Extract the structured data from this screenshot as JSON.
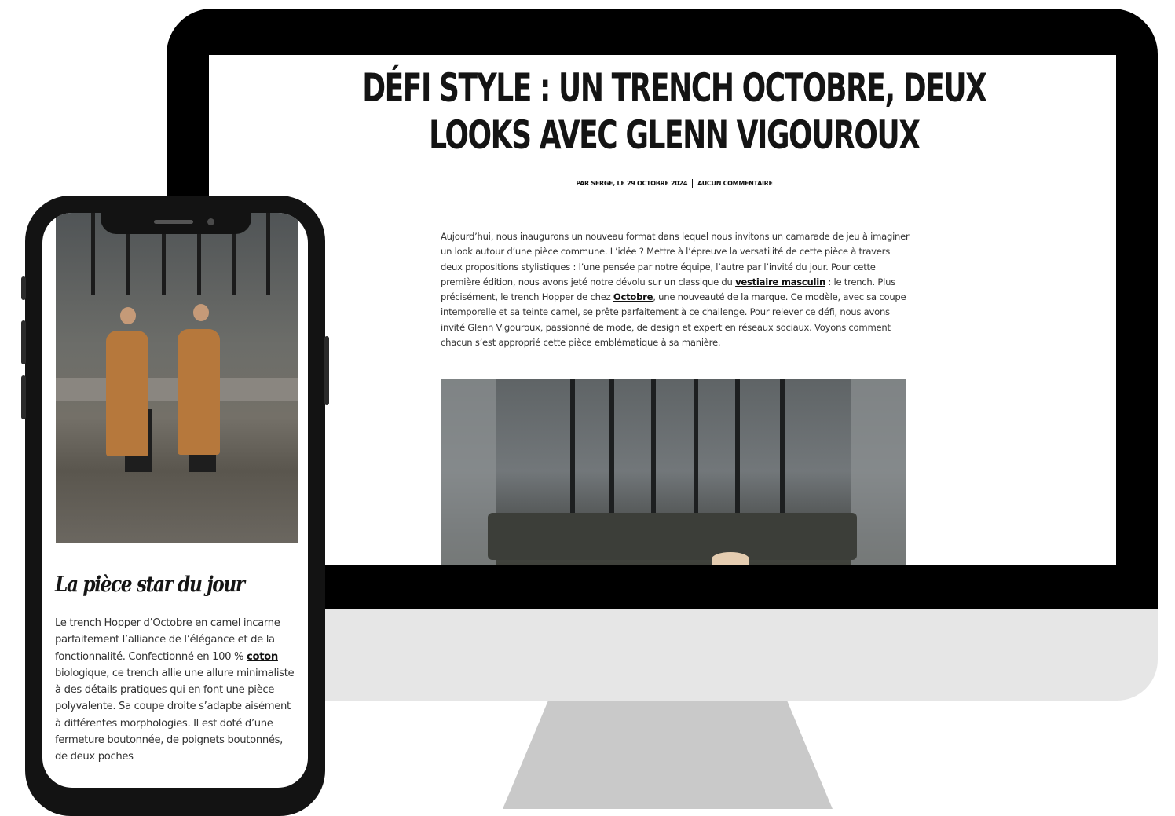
{
  "desktop": {
    "title": "DÉFI STYLE : UN TRENCH OCTOBRE, DEUX LOOKS AVEC GLENN VIGOUROUX",
    "byline": {
      "author_date": "PAR SERGE, LE 29 OCTOBRE 2024",
      "comments": "AUCUN COMMENTAIRE"
    },
    "intro": {
      "p1": "Aujourd’hui, nous inaugurons un nouveau format dans lequel nous invitons un camarade de jeu à imaginer un look autour d’une pièce commune. L’idée ? Mettre à l’épreuve la versatilité de cette pièce à travers deux propositions stylistiques : l’une pensée par notre équipe, l’autre par l’invité du jour. Pour cette première édition, nous avons jeté notre dévolu sur un classique du ",
      "link1": "vestiaire masculin",
      "p2": " : le trench. Plus précisément, le trench Hopper de chez ",
      "link2": "Octobre",
      "p3": ", une nouveauté de la marque. Ce modèle, avec sa coupe intemporelle et sa teinte camel, se prête parfaitement à ce challenge. Pour relever ce défi, nous avons invité Glenn Vigouroux, passionné de mode, de design et expert en réseaux sociaux. Voyons comment chacun s’est approprié cette pièce emblématique à sa manière."
    }
  },
  "mobile": {
    "heading": "La pièce star du jour",
    "body": {
      "p1": "Le trench Hopper d’Octobre en camel incarne parfaitement l’alliance de l’élégance et de la fonctionnalité. Confectionné en 100 % ",
      "link": "coton",
      "p2": " biologique, ce trench allie une allure minimaliste à des détails pratiques qui en font une pièce polyvalente. Sa coupe droite s’adapte aisément à différentes morphologies. Il est doté d’une fermeture boutonnée, de poignets boutonnés, de deux poches"
    }
  },
  "colors": {
    "device_black": "#000000",
    "phone_frame": "#131313",
    "monitor_chin": "#e6e6e6",
    "monitor_stand": "#c9c9c9",
    "coat_camel": "#b6783c"
  }
}
